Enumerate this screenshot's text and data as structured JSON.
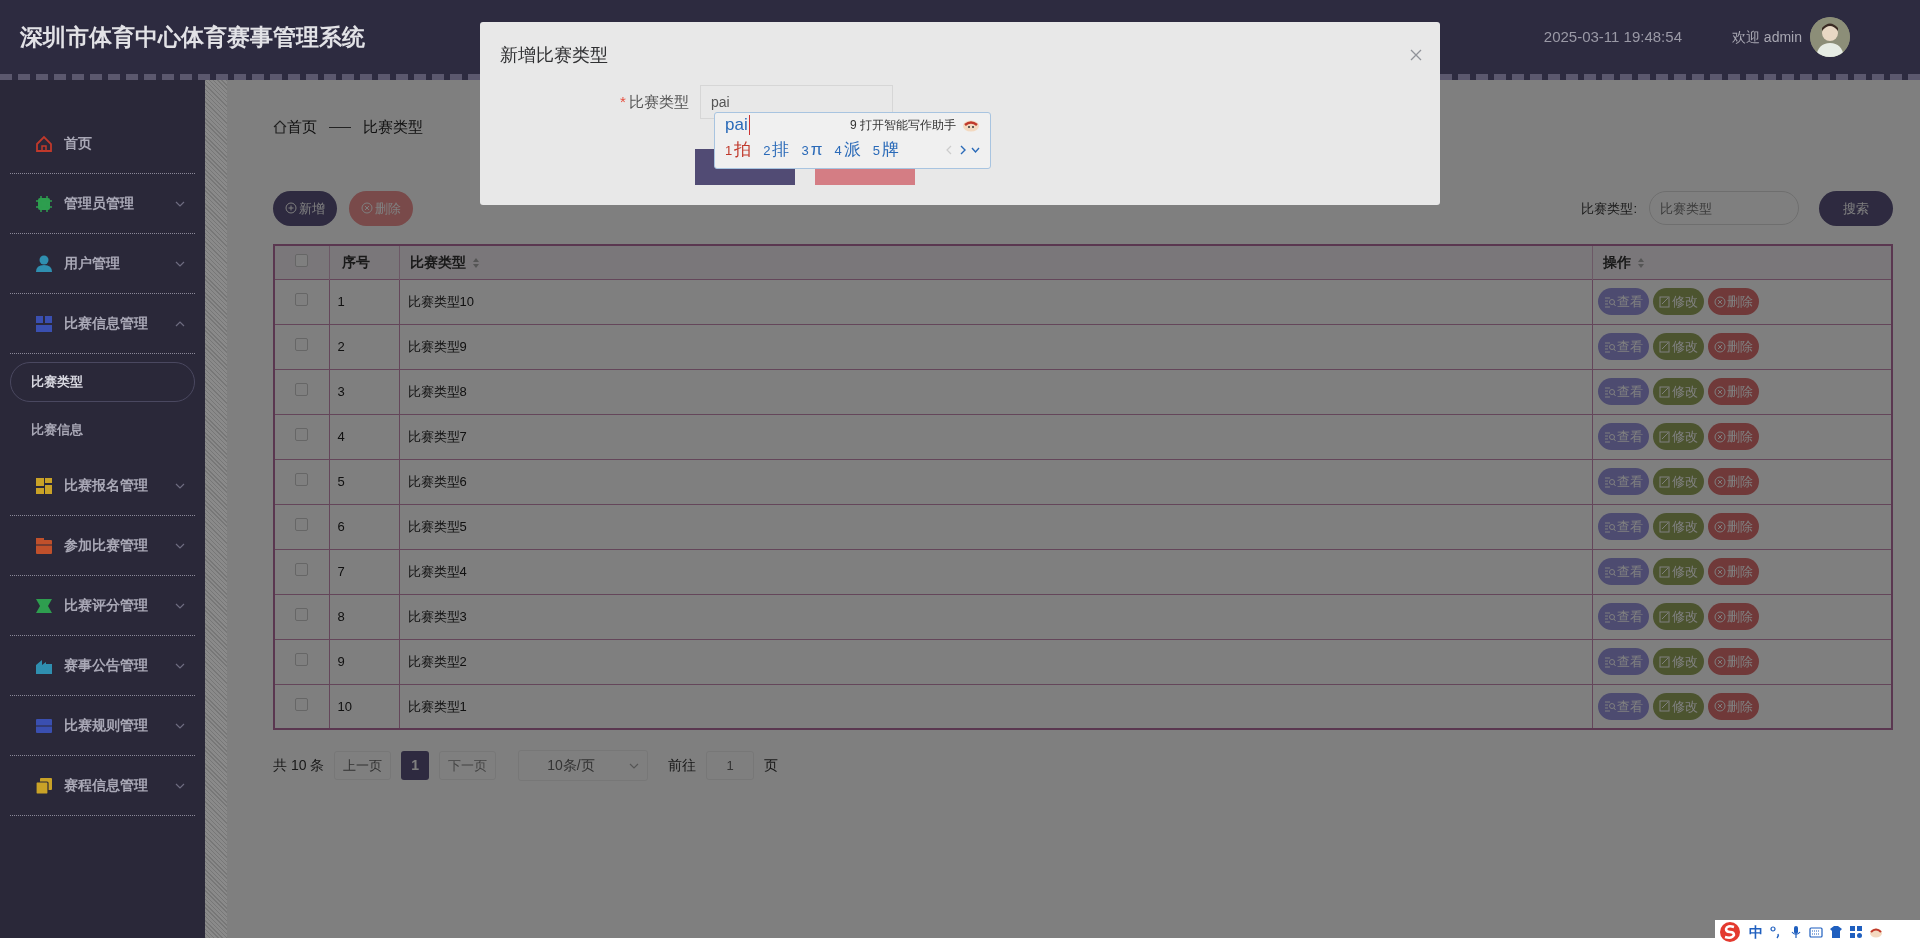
{
  "header": {
    "title": "深圳市体育中心体育赛事管理系统",
    "datetime": "2025-03-11 19:48:54",
    "welcome": "欢迎 admin"
  },
  "sidebar": {
    "items": [
      {
        "label": "首页",
        "color": "#c0392b"
      },
      {
        "label": "管理员管理",
        "color": "#2e9e4f",
        "expanded": false
      },
      {
        "label": "用户管理",
        "color": "#2f8fb0",
        "expanded": false
      },
      {
        "label": "比赛信息管理",
        "color": "#3a4fb0",
        "expanded": true,
        "children": [
          {
            "label": "比赛类型",
            "selected": true
          },
          {
            "label": "比赛信息",
            "selected": false
          }
        ]
      },
      {
        "label": "比赛报名管理",
        "color": "#c9a227",
        "expanded": false
      },
      {
        "label": "参加比赛管理",
        "color": "#c0502b",
        "expanded": false
      },
      {
        "label": "比赛评分管理",
        "color": "#2e9e4f",
        "expanded": false
      },
      {
        "label": "赛事公告管理",
        "color": "#2f8fb0",
        "expanded": false
      },
      {
        "label": "比赛规则管理",
        "color": "#3a4fb0",
        "expanded": false
      },
      {
        "label": "赛程信息管理",
        "color": "#c9a227",
        "expanded": false
      }
    ]
  },
  "breadcrumb": [
    "首页",
    "比赛类型"
  ],
  "toolbar": {
    "add": "新增",
    "delete": "删除"
  },
  "search": {
    "label": "比赛类型:",
    "placeholder": "比赛类型",
    "button": "搜索"
  },
  "table": {
    "select_all_checked": false,
    "columns": [
      {
        "label": "序号",
        "sortable": false
      },
      {
        "label": "比赛类型",
        "sortable": true
      },
      {
        "label": "操作",
        "sortable": true
      }
    ],
    "rows": [
      {
        "index": "1",
        "name": "比赛类型10",
        "checked": false,
        "actions": [
          "查看",
          "修改",
          "删除"
        ]
      },
      {
        "index": "2",
        "name": "比赛类型9",
        "checked": false,
        "actions": [
          "查看",
          "修改",
          "删除"
        ]
      },
      {
        "index": "3",
        "name": "比赛类型8",
        "checked": false,
        "actions": [
          "查看",
          "修改",
          "删除"
        ]
      },
      {
        "index": "4",
        "name": "比赛类型7",
        "checked": false,
        "actions": [
          "查看",
          "修改",
          "删除"
        ]
      },
      {
        "index": "5",
        "name": "比赛类型6",
        "checked": false,
        "actions": [
          "查看",
          "修改",
          "删除"
        ]
      },
      {
        "index": "6",
        "name": "比赛类型5",
        "checked": false,
        "actions": [
          "查看",
          "修改",
          "删除"
        ]
      },
      {
        "index": "7",
        "name": "比赛类型4",
        "checked": false,
        "actions": [
          "查看",
          "修改",
          "删除"
        ]
      },
      {
        "index": "8",
        "name": "比赛类型3",
        "checked": false,
        "actions": [
          "查看",
          "修改",
          "删除"
        ]
      },
      {
        "index": "9",
        "name": "比赛类型2",
        "checked": false,
        "actions": [
          "查看",
          "修改",
          "删除"
        ]
      },
      {
        "index": "10",
        "name": "比赛类型1",
        "checked": false,
        "actions": [
          "查看",
          "修改",
          "删除"
        ]
      }
    ]
  },
  "pagination": {
    "total": "共 10 条",
    "prev": "上一页",
    "pages": [
      {
        "label": "1",
        "selected": true
      }
    ],
    "next": "下一页",
    "page_size": "10条/页",
    "goto": "前往",
    "goto_value": "1",
    "goto_suffix": "页"
  },
  "modal": {
    "title": "新增比赛类型",
    "field": {
      "required_mark": "*",
      "label": "比赛类型",
      "value": "pai"
    },
    "buttons": [
      {
        "kind": "submit"
      },
      {
        "kind": "cancel"
      }
    ]
  },
  "ime": {
    "composition": "pai",
    "assistant": "9 打开智能写作助手",
    "candidates": [
      {
        "number": "1",
        "text": "拍",
        "selected": true
      },
      {
        "number": "2",
        "text": "排",
        "selected": false
      },
      {
        "number": "3",
        "text": "π",
        "selected": false
      },
      {
        "number": "4",
        "text": "派",
        "selected": false
      },
      {
        "number": "5",
        "text": "牌",
        "selected": false
      }
    ]
  },
  "tray": {
    "mode": "中"
  }
}
